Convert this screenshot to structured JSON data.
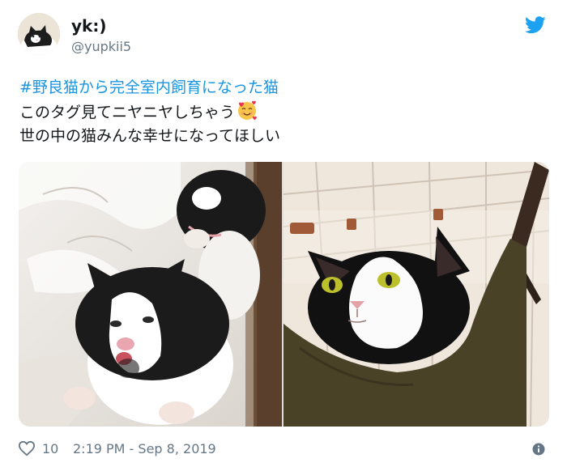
{
  "tweet": {
    "user": {
      "name": "yk:)",
      "handle": "@yupkii5",
      "avatar_icon": "cat-avatar"
    },
    "text": {
      "hashtag": "#野良猫から完全室内飼育になった猫",
      "line2": "このタグ見てニヤニヤしちゃう",
      "line2_emoji": "smiling-face-with-hearts-emoji",
      "line3": "世の中の猫みんな幸せになってほしい"
    },
    "likes": "10",
    "timestamp": "2:19 PM - Sep 8, 2019"
  },
  "colors": {
    "accent": "#1b95e0",
    "muted": "#657786",
    "twitter_blue": "#1da1f2"
  },
  "icons": [
    "cat-avatar",
    "twitter-bird-icon",
    "smiling-face-with-hearts-emoji",
    "heart-icon",
    "info-icon"
  ]
}
